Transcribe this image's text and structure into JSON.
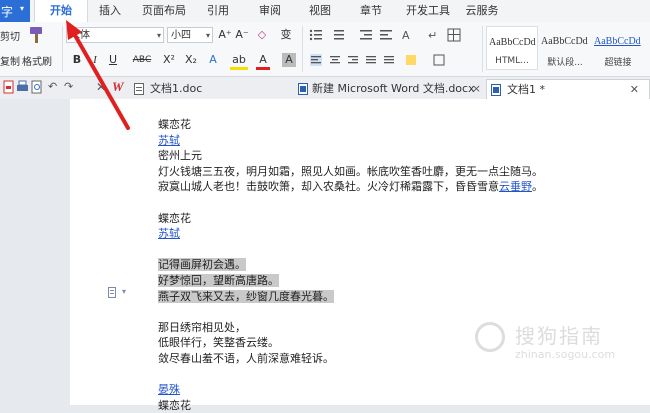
{
  "app_menu": {
    "label": "字",
    "arrow": "▾"
  },
  "menu_tabs": [
    {
      "label": "开始",
      "active": true
    },
    {
      "label": "插入"
    },
    {
      "label": "页面布局"
    },
    {
      "label": "引用"
    },
    {
      "label": "审阅"
    },
    {
      "label": "视图"
    },
    {
      "label": "章节"
    },
    {
      "label": "开发工具"
    },
    {
      "label": "云服务"
    }
  ],
  "ribbon": {
    "cut_label": "剪切",
    "copy_label": "复制",
    "format_painter_label": "格式刷",
    "font_name": "宋体",
    "font_size": "小四",
    "style_gallery": [
      {
        "sample": "AaBbCcDd",
        "name": "HTML..."
      },
      {
        "sample": "AaBbCcDd",
        "name": "默认段..."
      },
      {
        "sample": "AaBbCcDd",
        "name": "超链接"
      }
    ],
    "glyphs": {
      "grow_font": "A⁺",
      "shrink_font": "A⁻",
      "clear_format": "◇",
      "phonetic": "变",
      "bold": "B",
      "italic": "I",
      "underline": "U",
      "strike": "ABC",
      "superscript": "X²",
      "subscript": "X₂",
      "text_effect": "A",
      "highlight": "ab",
      "font_color": "A",
      "char_border": "A"
    }
  },
  "doc_tabs": [
    {
      "label": "文档1.doc",
      "icon": "wps-doc-icon"
    },
    {
      "label": "新建 Microsoft Word 文档.docx",
      "icon": "word-doc-icon"
    },
    {
      "label": "文档1 *",
      "icon": "word-doc-icon",
      "active": true
    }
  ],
  "document": {
    "lines": [
      {
        "text": "蝶恋花",
        "type": "plain"
      },
      {
        "text": "苏轼",
        "type": "link"
      },
      {
        "text": "密州上元",
        "type": "plain"
      },
      {
        "text": "灯火钱塘三五夜，明月如霜，照见人如画。帐底吹笙香吐麝，更无一点尘随马。",
        "type": "plain"
      },
      {
        "text": "寂寞山城人老也！击鼓吹箫，却入农桑社。火冷灯稀霜露下，昏昏雪意",
        "type": "plain",
        "link_suffix": "云垂野",
        "suffix": "。"
      },
      {
        "text": "",
        "type": "blank"
      },
      {
        "text": "蝶恋花",
        "type": "plain"
      },
      {
        "text": "苏轼",
        "type": "link"
      },
      {
        "text": "",
        "type": "blank"
      },
      {
        "text": "记得画屏初会遇。",
        "type": "selected"
      },
      {
        "text": "好梦惊回，望断高唐路。",
        "type": "selected"
      },
      {
        "text": "燕子双飞来又去，纱窗几度春光暮。",
        "type": "selected"
      },
      {
        "text": "",
        "type": "blank"
      },
      {
        "text": "那日绣帘相见处，",
        "type": "plain"
      },
      {
        "text": "低眼佯行，笑整香云缕。",
        "type": "plain"
      },
      {
        "text": "敛尽春山羞不语，人前深意难轻诉。",
        "type": "plain"
      },
      {
        "text": "",
        "type": "blank"
      },
      {
        "text": "晏殊",
        "type": "link"
      },
      {
        "text": "蝶恋花",
        "type": "plain"
      }
    ]
  },
  "watermark": {
    "cn": "搜狗指南",
    "en": "zhinan.sogou.com"
  },
  "colors": {
    "accent": "#2b6fd6",
    "link": "#2255cc",
    "selection": "#c9c9c9",
    "arrow": "#e02020"
  }
}
